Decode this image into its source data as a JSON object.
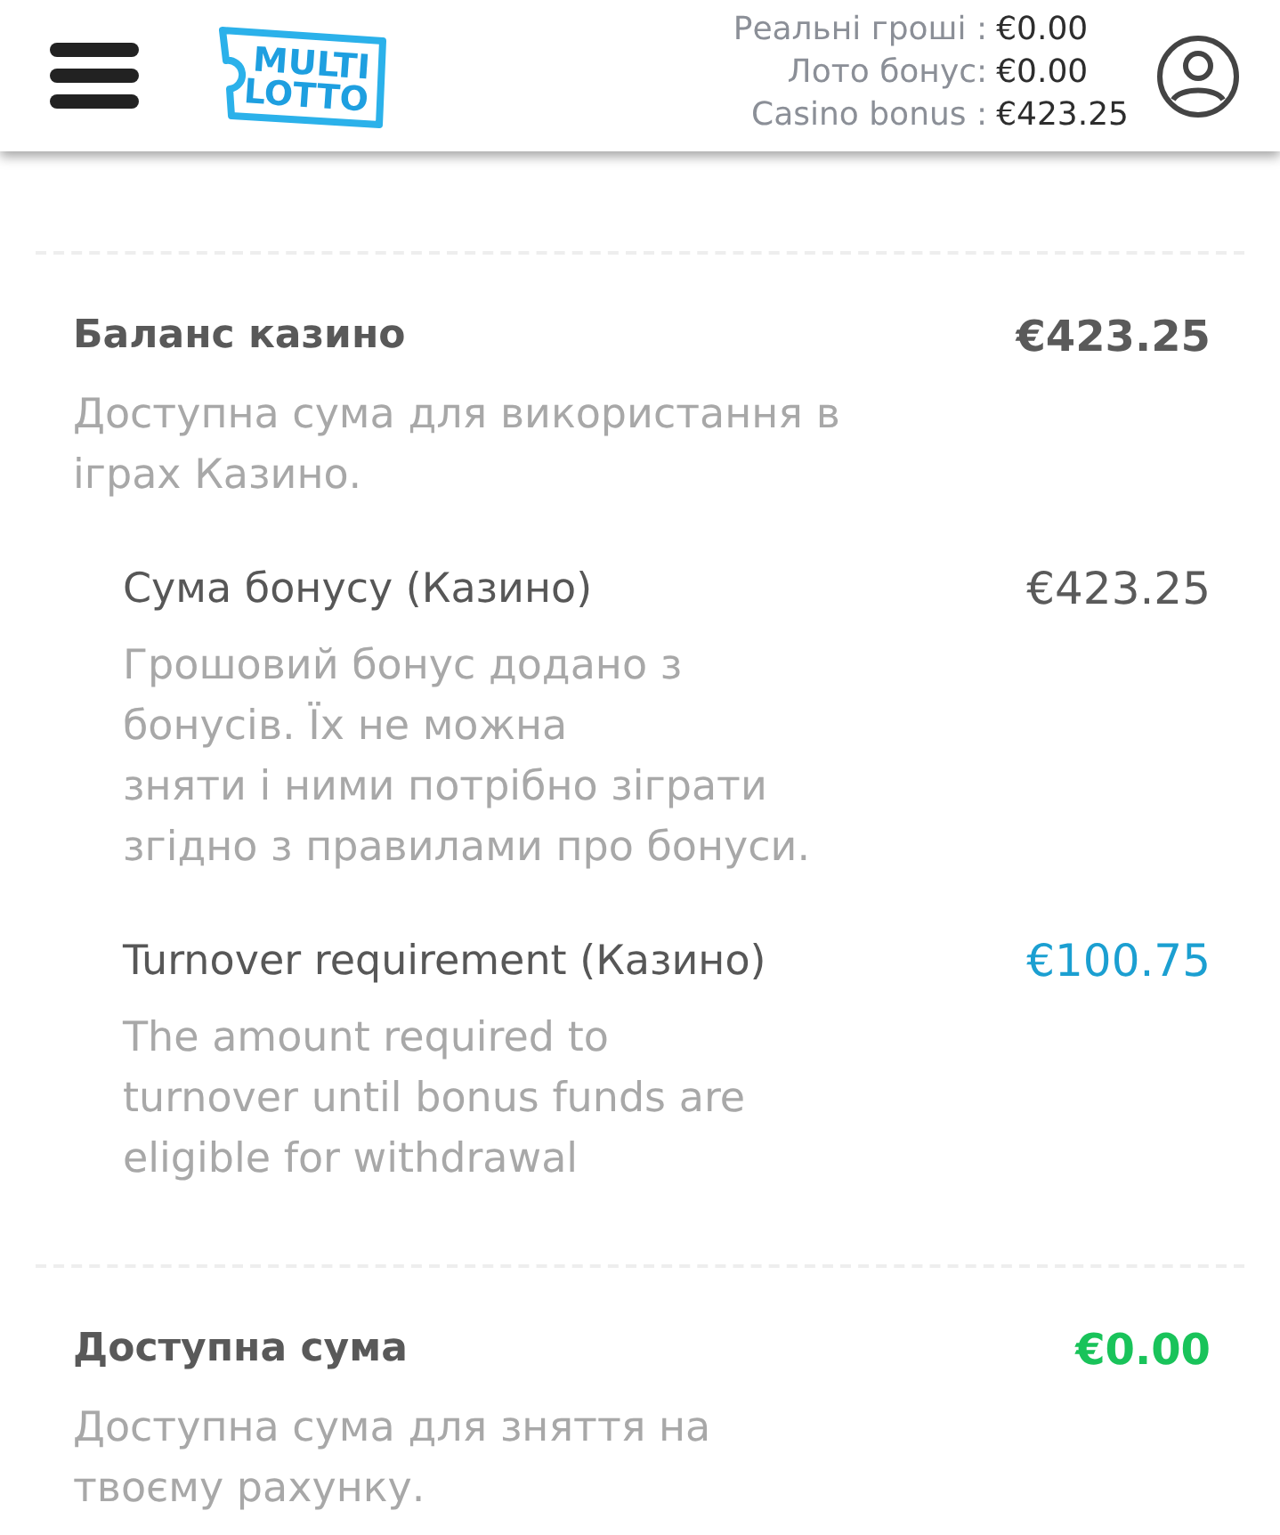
{
  "header": {
    "logo": {
      "line_1": "MULTI",
      "line_2": "LOTTO"
    },
    "balances": [
      {
        "label": "Реальні гроші :",
        "value": "€0.00"
      },
      {
        "label": "Лото бонус:",
        "value": "€0.00"
      },
      {
        "label": "Casino bonus :",
        "value": "€423.25"
      }
    ]
  },
  "sections": [
    {
      "title": "Баланс казино",
      "value": "€423.25",
      "color": "#5a5a5a",
      "description": "Доступна сума для використання в\nіграх Казино.",
      "children": [
        {
          "title": "Сума бонусу (Казино)",
          "value": "€423.25",
          "color": "#5a5a5a",
          "description": "Грошовий бонус додано з\nбонусів. Їх не можна\nзняти і ними потрібно зіграти\nзгідно з правилами про бонуси."
        },
        {
          "title": "Turnover requirement (Казино)",
          "value": "€100.75",
          "color": "#1b9fd1",
          "description": "The amount required to\nturnover until bonus funds are\neligible for withdrawal"
        }
      ]
    },
    {
      "title": "Доступна сума",
      "value": "€0.00",
      "color": "#19c35a",
      "description": "Доступна сума для зняття на\nтвоєму рахунку."
    }
  ]
}
